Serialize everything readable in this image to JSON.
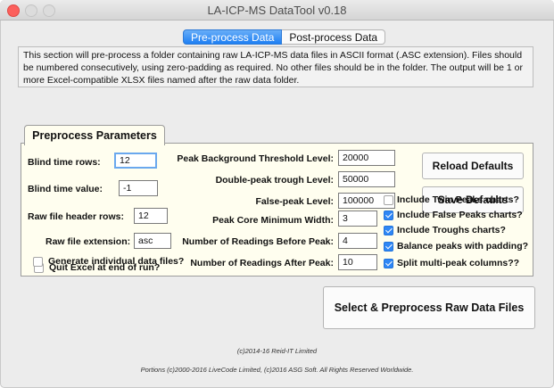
{
  "window": {
    "title": "LA-ICP-MS DataTool v0.18"
  },
  "tabs": [
    {
      "label": "Pre-process Data",
      "active": true
    },
    {
      "label": "Post-process Data",
      "active": false
    }
  ],
  "description": "This section will pre-process a folder containing raw LA-ICP-MS data files in ASCII format (.ASC extension). Files should be numbered consecutively, using zero-padding as required. No other files should be in the folder. The output will be 1 or more Excel-compatible XLSX files named after the raw data folder.",
  "panel_tab": "Preprocess Parameters",
  "left_fields": [
    {
      "label": "Blind time rows:",
      "value": "12"
    },
    {
      "label": "Blind time value:",
      "value": "-1"
    },
    {
      "label": "Raw file header rows:",
      "value": "12"
    },
    {
      "label": "Raw file extension:",
      "value": "asc"
    }
  ],
  "left_checks": [
    {
      "label": "Quit Excel at end of run?",
      "checked": false
    },
    {
      "label": "Generate individual data files?",
      "checked": false
    }
  ],
  "mid_fields": [
    {
      "label": "Peak Background Threshold Level:",
      "value": "20000"
    },
    {
      "label": "Double-peak trough Level:",
      "value": "50000"
    },
    {
      "label": "False-peak Level:",
      "value": "100000"
    },
    {
      "label": "Peak Core Minimum Width:",
      "value": "3"
    },
    {
      "label": "Number of Readings Before Peak:",
      "value": "4"
    },
    {
      "label": "Number of Readings After Peak:",
      "value": "10"
    }
  ],
  "buttons": {
    "reload": "Reload Defaults",
    "save": "Save Defaults",
    "select": "Select & Preprocess Raw Data Files"
  },
  "right_checks": [
    {
      "label": "Include Twin Peaks charts?",
      "checked": false
    },
    {
      "label": "Include False Peaks charts?",
      "checked": true
    },
    {
      "label": "Include Troughs charts?",
      "checked": true
    },
    {
      "label": "Balance peaks with padding?",
      "checked": true
    },
    {
      "label": "Split multi-peak columns??",
      "checked": true
    }
  ],
  "footer": {
    "copyright": "(c)2014-16 Reid-IT Limited",
    "portions": "Portions (c)2000-2016 LiveCode Limited, (c)2016 ASG Soft. All Rights Reserved Worldwide."
  },
  "colors": {
    "accent": "#2f87f5",
    "panel": "#fffeef",
    "close": "#fc605c"
  }
}
